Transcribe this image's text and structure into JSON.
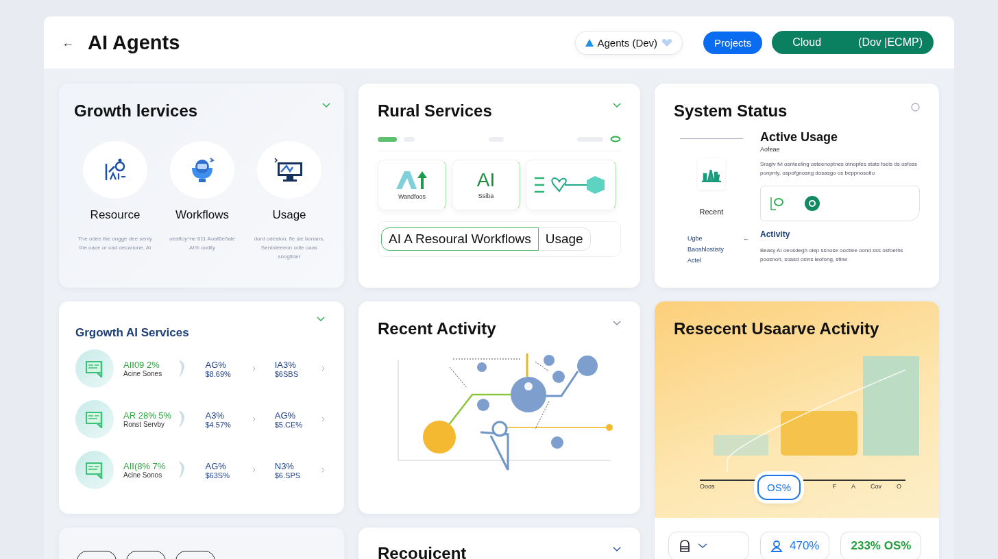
{
  "header": {
    "back": "←",
    "title": "AI Agents",
    "env_chip": "Agents (Dev)",
    "projects_button": "Projects",
    "cloud_button": {
      "label": "Cloud",
      "suffix": "(Dov |ECMP)"
    }
  },
  "growth_card": {
    "title": "Growth lervices",
    "items": [
      {
        "label": "Resource",
        "kind": "ai",
        "description": "The odee the ongge dee seniy the oace or oad oecanone, AI"
      },
      {
        "label": "Workflows",
        "kind": "robot",
        "description": "oeaftoy^ne 611 Aoaf6e0ale AI% oodlly"
      },
      {
        "label": "Usage",
        "kind": "monitor",
        "description": "dord odeaion, fle sle bonans, Senbdeeeon odie oaas snogflder"
      }
    ]
  },
  "rural_card": {
    "title": "Rural Services",
    "tiles": [
      {
        "kind": "logo",
        "caption": "Wandfoos"
      },
      {
        "kind": "letters",
        "big": "AI",
        "caption": "Ssiba"
      },
      {
        "kind": "flow"
      }
    ],
    "segments": [
      {
        "label": "AI A Resoural Workflows",
        "selected": true
      },
      {
        "label": "Usage",
        "selected": false
      }
    ]
  },
  "status_card": {
    "title": "System Status",
    "recent": "Recent",
    "links": [
      {
        "label": "Ugbe",
        "arrow": "←"
      },
      {
        "label": "Baoshlostisty"
      },
      {
        "label": "Actel"
      }
    ],
    "active_title": "Active Usage",
    "active_sub": "Aofeae",
    "active_text": "Sragiv fvl osnteeling osteenoptnes otnopfes stats foels ds osfoss ponpnty, ospofgnosng dosasgo os beppnosotio",
    "activity_title": "Activity",
    "activity_text": "Beasy AI oeosdegh olep ssnose ooctiee oond sss osfoeths poosnoh, soasd osins leofong, stine"
  },
  "services_card": {
    "title": "Grgowth AI Services",
    "rows": [
      {
        "primary": "AII09 2%",
        "secondary": "Acine Sones",
        "col2_top": "AG%",
        "col2_bottom": "$8.69%",
        "col3_top": "IA3%",
        "col3_bottom": "$6SBS"
      },
      {
        "primary": "AR 28% 5%",
        "secondary": "Ronst Servby",
        "col2_top": "A3%",
        "col2_bottom": "$4.57%",
        "col3_top": "AG%",
        "col3_bottom": "$5.CE%"
      },
      {
        "primary": "AII(8% 7%",
        "secondary": "Acine Sonos",
        "col2_top": "AG%",
        "col2_bottom": "$63S%",
        "col3_top": "N3%",
        "col3_bottom": "$6.SPS"
      }
    ]
  },
  "activity_card": {
    "title": "Recent Activity"
  },
  "usage_card": {
    "title": "Resecent Usaarve Activity",
    "axis_labels": [
      "Ooos",
      "F",
      "A",
      "Cov",
      "O"
    ],
    "bubble": "OS%",
    "chips": [
      {
        "kind": "dropdown"
      },
      {
        "kind": "person",
        "value": "470%"
      },
      {
        "kind": "text",
        "value": "233% OS%"
      }
    ]
  },
  "bottom_card": {
    "title": "Recouicent"
  }
}
